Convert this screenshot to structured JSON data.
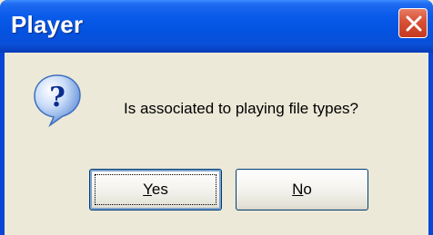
{
  "window": {
    "title": "Player"
  },
  "titlebar": {
    "close_icon": "close-x-icon"
  },
  "dialog": {
    "icon": "question-mark-icon",
    "message": "Is associated to playing file types?"
  },
  "buttons": {
    "yes": {
      "mnemonic": "Y",
      "rest": "es"
    },
    "no": {
      "mnemonic": "N",
      "rest": "o"
    }
  },
  "colors": {
    "titlebar": "#0453E0",
    "close_button": "#D8543A",
    "dialog_face": "#ECE9D8",
    "button_border": "#003C74"
  }
}
